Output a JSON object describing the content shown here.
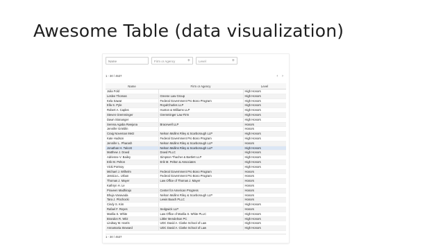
{
  "slide": {
    "title": "Awesome Table (data visualization)"
  },
  "filters": {
    "name_placeholder": "Name",
    "firm_label": "Firm or Agency",
    "level_label": "Level",
    "plus_icon": "+"
  },
  "pager": {
    "top_range": "1 - 30 / 4537",
    "bottom_range": "1 - 30 / 4537",
    "prev_icon": "‹",
    "next_icon": "›"
  },
  "table": {
    "columns": [
      "Name",
      "Firm or Agency",
      "Level"
    ],
    "rows": [
      {
        "name": "Julia Fold",
        "firm": "",
        "level": "High Honors"
      },
      {
        "name": "Leslee Thomas",
        "firm": "Greene Law Group",
        "level": "High Honors"
      },
      {
        "name": "Kela Sawar",
        "firm": "Federal Government Pro Bono Program",
        "level": "High Honors"
      },
      {
        "name": "Ella S. Pyle",
        "firm": "RoyalCharles LLP",
        "level": "High Honors"
      },
      {
        "name": "Robert A. Caples",
        "firm": "Hunton & Williams LLP",
        "level": "High Honors"
      },
      {
        "name": "Steven Gremminger",
        "firm": "Gremminger Law Firm",
        "level": "High Honors"
      },
      {
        "name": "Dawn Stonanger",
        "firm": "",
        "level": "High Honors"
      },
      {
        "name": "Serena Agaba Rwejuna",
        "firm": "Bracewell LLP",
        "level": "Honors"
      },
      {
        "name": "Jennifer Grieblin",
        "firm": "",
        "level": "Honors"
      },
      {
        "name": "Craig Noveman Metz",
        "firm": "Nelson Mullins Riley & Scarborough LLP",
        "level": "High Honors"
      },
      {
        "name": "Kate Hudson",
        "firm": "Federal Government Pro Bono Program",
        "level": "High Honors"
      },
      {
        "name": "Jennifer L. Pharash",
        "firm": "Nelson Mullins Riley & Scarborough LLP",
        "level": "Honors"
      },
      {
        "name": "Jonathan H. Talcott",
        "firm": "Nelson Mullins Riley & Scarborough LLP",
        "level": "High Honors"
      },
      {
        "name": "Matthew J. Dowd",
        "firm": "Dowd PLLC",
        "level": "High Honors"
      },
      {
        "name": "Adrienne V. Bailey",
        "firm": "Simpson Thacher & Bartlett LLP",
        "level": "High Honors"
      },
      {
        "name": "Erik M. Pelton",
        "firm": "Erik M. Pelton & Associates",
        "level": "High Honors"
      },
      {
        "name": "Vicki Portnoy",
        "firm": "",
        "level": "High Honors"
      },
      {
        "name": "Michael J. Wilhelm",
        "firm": "Federal Government Pro Bono Program",
        "level": "Honors"
      },
      {
        "name": "Jessica L. Urban",
        "firm": "Federal Government Pro Bono Program",
        "level": "Honors"
      },
      {
        "name": "Thomas J. Mayer",
        "firm": "Law Office of Thomas J. Mayer",
        "level": "Honors"
      },
      {
        "name": "Kathryn H. Le",
        "firm": "",
        "level": "Honors"
      },
      {
        "name": "Praveen Madhirajo",
        "firm": "Center for American Progress",
        "level": "Honors"
      },
      {
        "name": "Bhuja Vanavada",
        "firm": "Nelson Mullins Riley & Scarborough LLP",
        "level": "Honors"
      },
      {
        "name": "Tara J. Plochocki",
        "firm": "Lewis Baach PLLC",
        "level": "Honors"
      },
      {
        "name": "Cindy S. Kim",
        "firm": "",
        "level": "High Honors"
      },
      {
        "name": "Rafael F. Reyes",
        "firm": "Sedgwick LLP",
        "level": "Honors"
      },
      {
        "name": "Marilia S. White",
        "firm": "Law Office of Marilia S. White PLLC",
        "level": "High Honors"
      },
      {
        "name": "Brandon R. Witz",
        "firm": "Littler Mendelson PC",
        "level": "High Honors"
      },
      {
        "name": "Lindsay M. Harris",
        "firm": "UDC David A. Clarke School of Law",
        "level": "High Honors"
      },
      {
        "name": "Annamaria Steward",
        "firm": "UDC David A. Clarke School of Law",
        "level": "High Honors"
      }
    ]
  }
}
